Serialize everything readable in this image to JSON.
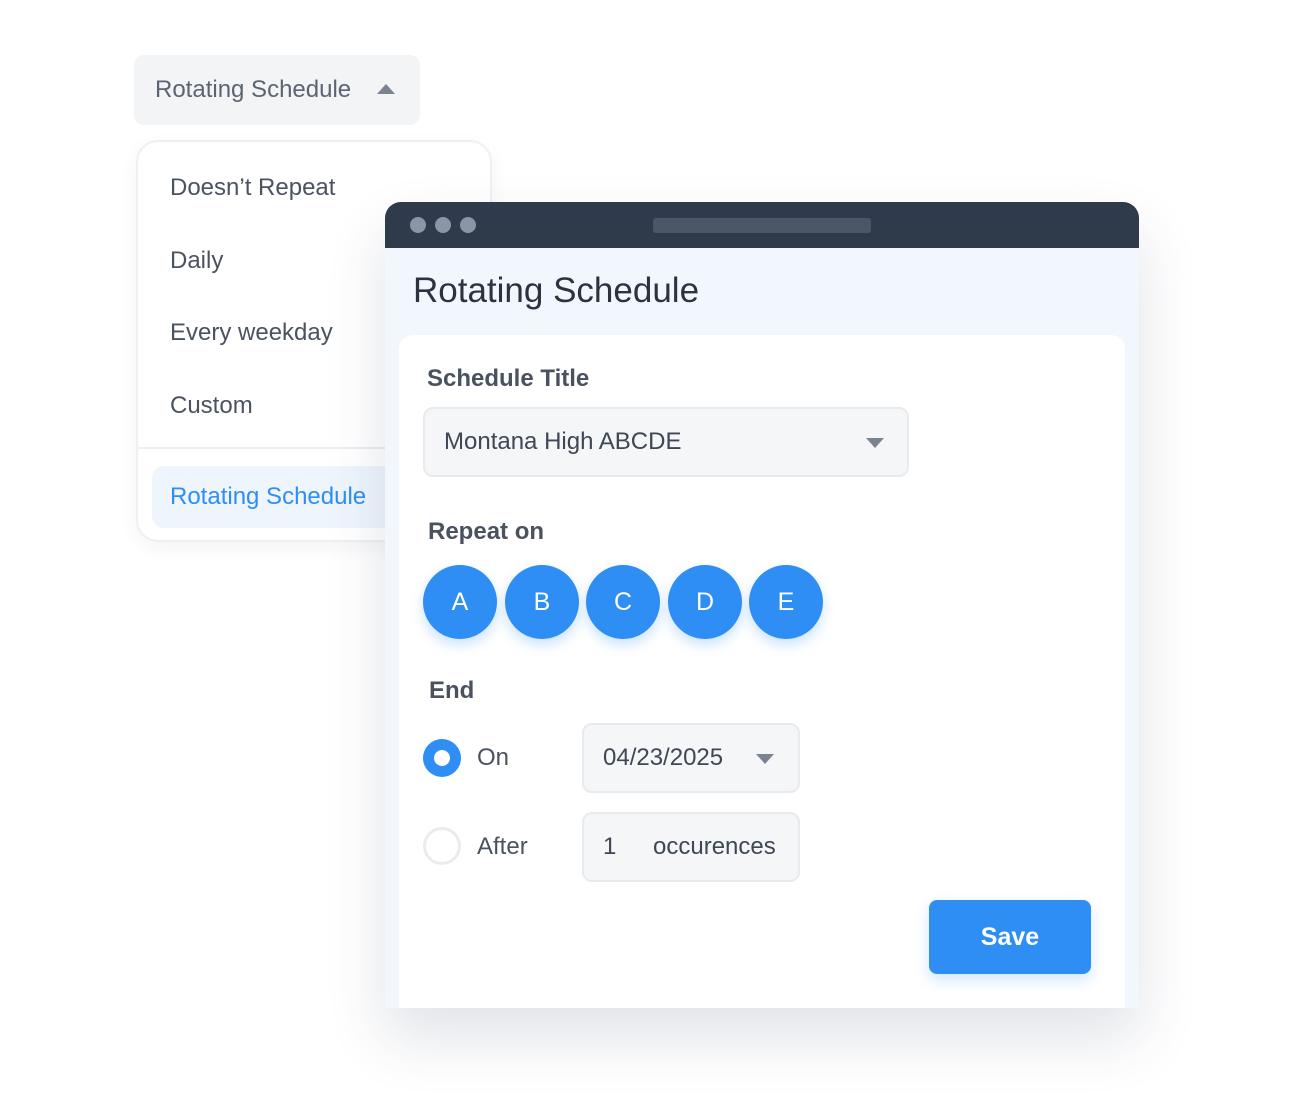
{
  "repeat_dropdown": {
    "selected_label": "Rotating Schedule",
    "caret_icon": "caret-up-icon",
    "options": [
      "Doesn’t Repeat",
      "Daily",
      "Every weekday",
      "Custom",
      "Rotating Schedule"
    ],
    "selected_option": "Rotating Schedule"
  },
  "dialog": {
    "title": "Rotating Schedule",
    "schedule_title": {
      "label": "Schedule Title",
      "value": "Montana High ABCDE"
    },
    "repeat_on": {
      "label": "Repeat on",
      "days": [
        "A",
        "B",
        "C",
        "D",
        "E"
      ]
    },
    "end": {
      "label": "End",
      "on": {
        "label": "On",
        "checked": true,
        "date": "04/23/2025"
      },
      "after": {
        "label": "After",
        "checked": false,
        "count": "1",
        "unit": "occurences"
      }
    },
    "save_label": "Save"
  },
  "colors": {
    "accent": "#2e8ef3",
    "titlebar": "#2f3a4b",
    "dialog_bg": "#f2f7fd",
    "text_primary": "#2b3340",
    "text_secondary": "#4a5260"
  }
}
